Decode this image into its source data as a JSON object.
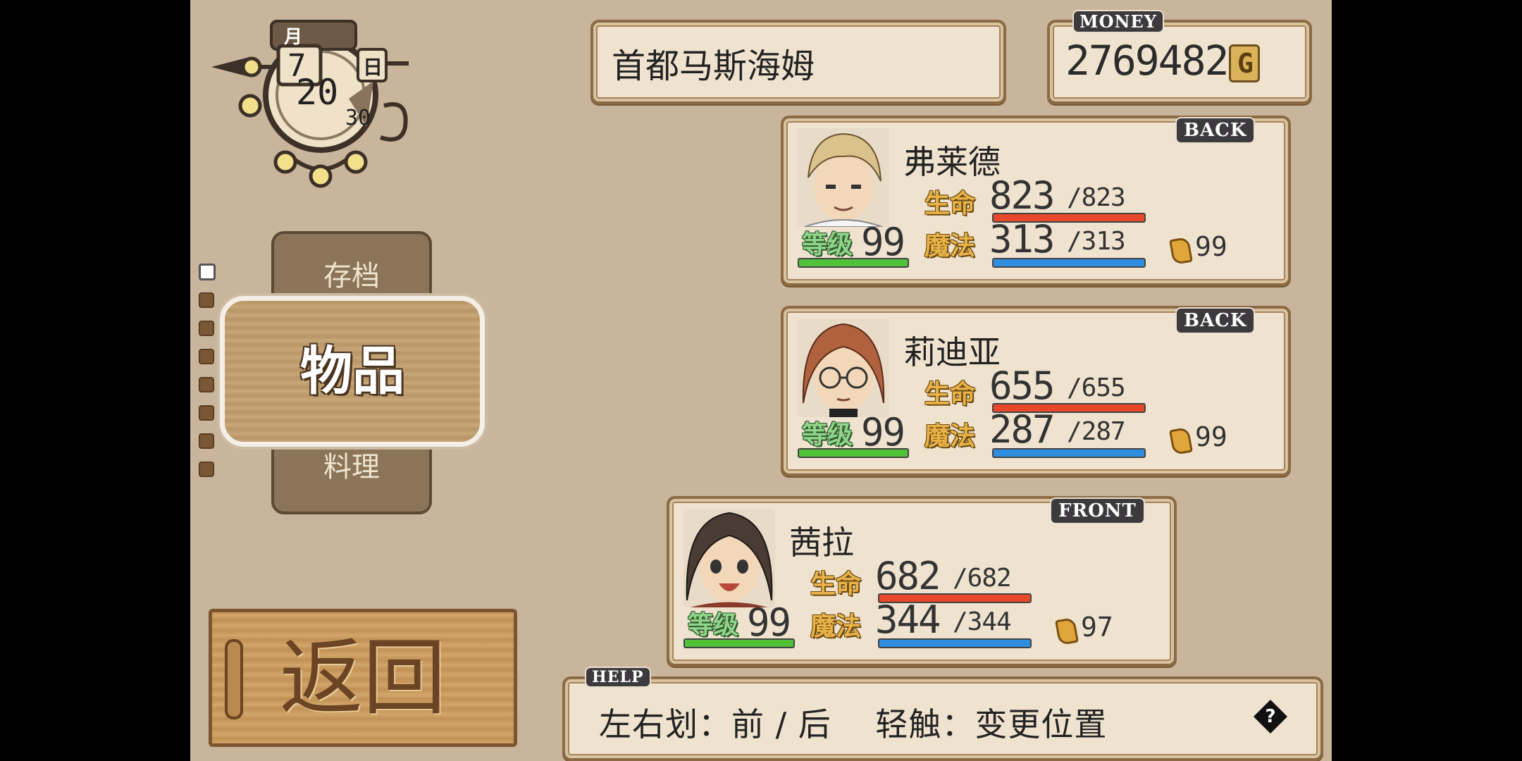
{
  "calendar": {
    "month_label": "月",
    "month": "7",
    "day_label": "日",
    "day": "20",
    "days_total": "30"
  },
  "location": "首都马斯海姆",
  "money": {
    "label": "MONEY",
    "value": "2769482",
    "currency_icon": "G"
  },
  "menu": {
    "items": [
      {
        "label": "存档"
      },
      {
        "label": "物品",
        "selected": true
      },
      {
        "label": "料理"
      }
    ],
    "page_dots": 8,
    "selected_dot": 0
  },
  "back_button": {
    "label": "返回"
  },
  "party": [
    {
      "name": "弗莱德",
      "position": "BACK",
      "hp_label": "生命",
      "hp": "823",
      "hp_max": "/823",
      "mp_label": "魔法",
      "mp": "313",
      "mp_max": "/313",
      "lv_label": "等级",
      "level": "99",
      "tp": "99",
      "hair_color": "#d9c28c"
    },
    {
      "name": "莉迪亚",
      "position": "BACK",
      "hp_label": "生命",
      "hp": "655",
      "hp_max": "/655",
      "mp_label": "魔法",
      "mp": "287",
      "mp_max": "/287",
      "lv_label": "等级",
      "level": "99",
      "tp": "99",
      "hair_color": "#b0623e"
    },
    {
      "name": "茜拉",
      "position": "FRONT",
      "hp_label": "生命",
      "hp": "682",
      "hp_max": "/682",
      "mp_label": "魔法",
      "mp": "344",
      "mp_max": "/344",
      "lv_label": "等级",
      "level": "99",
      "tp": "97",
      "hair_color": "#4a3b35"
    }
  ],
  "help": {
    "tag": "HELP",
    "text": "左右划：前 / 后　 轻触：变更位置",
    "icon": "question-diamond-icon"
  },
  "colors": {
    "hp_bar": "#e8472a",
    "mp_bar": "#2f8ee0",
    "lv_bar": "#4fc23a",
    "background": "#c9b49c"
  }
}
